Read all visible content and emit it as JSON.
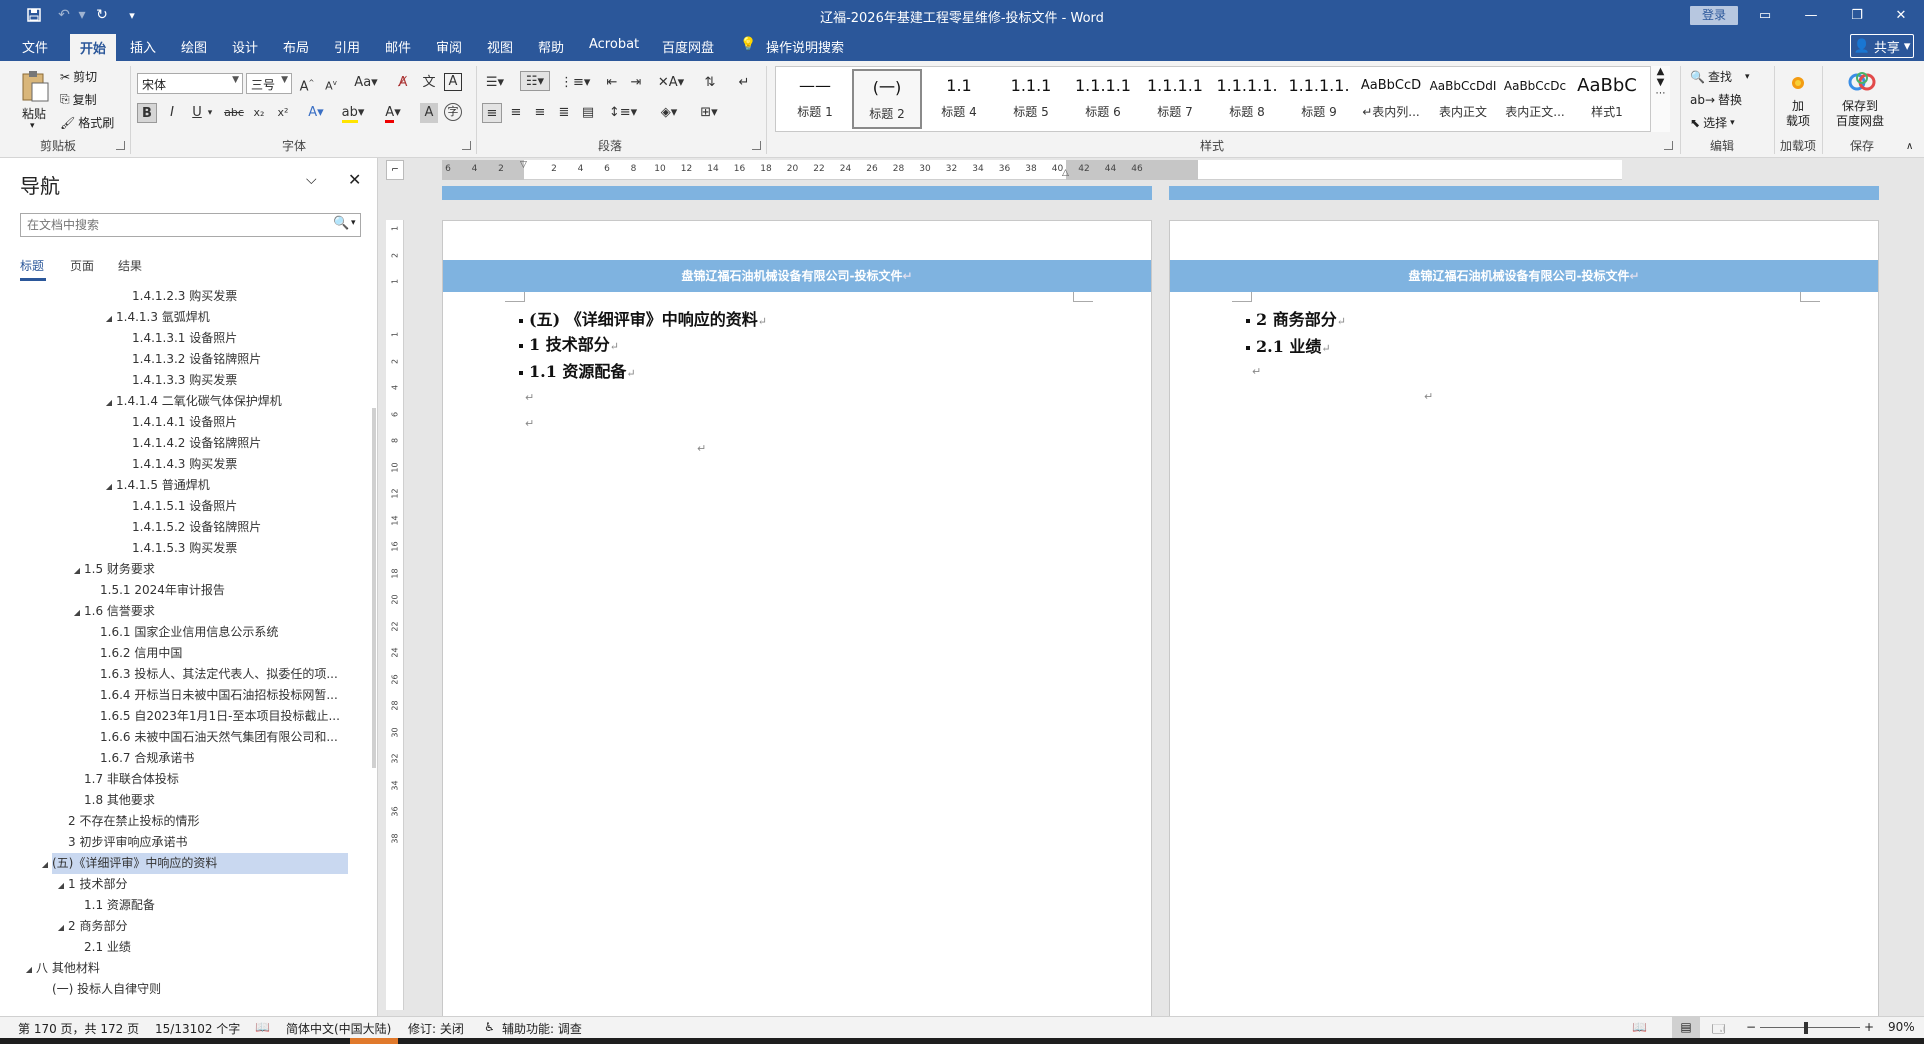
{
  "window": {
    "title": "辽福-2026年基建工程零星维修-投标文件 - Word",
    "login": "登录",
    "share": "共享"
  },
  "menu": [
    "文件",
    "开始",
    "插入",
    "绘图",
    "设计",
    "布局",
    "引用",
    "邮件",
    "审阅",
    "视图",
    "帮助",
    "Acrobat",
    "百度网盘",
    "操作说明搜索"
  ],
  "ribbon": {
    "clipboard": {
      "paste": "粘贴",
      "cut": "剪切",
      "copy": "复制",
      "format_painter": "格式刷",
      "label": "剪贴板"
    },
    "font": {
      "name": "宋体",
      "size": "三号",
      "label": "字体"
    },
    "paragraph": {
      "label": "段落"
    },
    "styles": {
      "label": "样式",
      "items": [
        {
          "preview": "——",
          "name": "标题 1"
        },
        {
          "preview": "(一)",
          "name": "标题 2"
        },
        {
          "preview": "1.1",
          "name": "标题 4"
        },
        {
          "preview": "1.1.1",
          "name": "标题 5"
        },
        {
          "preview": "1.1.1.1",
          "name": "标题 6"
        },
        {
          "preview": "1.1.1.1",
          "name": "标题 7"
        },
        {
          "preview": "1.1.1.1.",
          "name": "标题 8"
        },
        {
          "preview": "1.1.1.1.",
          "name": "标题 9"
        },
        {
          "preview": "AaBbCcD",
          "name": "↵表内列..."
        },
        {
          "preview": "AaBbCcDdI",
          "name": "表内正文"
        },
        {
          "preview": "AaBbCcDc",
          "name": "表内正文..."
        },
        {
          "preview": "AaBbC",
          "name": "样式1"
        }
      ]
    },
    "editing": {
      "find": "查找",
      "replace": "替换",
      "select": "选择",
      "label": "编辑"
    },
    "addins": {
      "btn": "加\n载项",
      "label": "加载项"
    },
    "save": {
      "btn": "保存到\n百度网盘",
      "label": "保存"
    }
  },
  "nav": {
    "title": "导航",
    "search_placeholder": "在文档中搜索",
    "tabs": [
      "标题",
      "页面",
      "结果"
    ],
    "items": [
      {
        "text": "1.4.1.2.3 购买发票",
        "level": 5,
        "tri": ""
      },
      {
        "text": "1.4.1.3 氩弧焊机",
        "level": 4,
        "tri": "◢"
      },
      {
        "text": "1.4.1.3.1 设备照片",
        "level": 5,
        "tri": ""
      },
      {
        "text": "1.4.1.3.2 设备铭牌照片",
        "level": 5,
        "tri": ""
      },
      {
        "text": "1.4.1.3.3 购买发票",
        "level": 5,
        "tri": ""
      },
      {
        "text": "1.4.1.4 二氧化碳气体保护焊机",
        "level": 4,
        "tri": "◢"
      },
      {
        "text": "1.4.1.4.1 设备照片",
        "level": 5,
        "tri": ""
      },
      {
        "text": "1.4.1.4.2 设备铭牌照片",
        "level": 5,
        "tri": ""
      },
      {
        "text": "1.4.1.4.3 购买发票",
        "level": 5,
        "tri": ""
      },
      {
        "text": "1.4.1.5 普通焊机",
        "level": 4,
        "tri": "◢"
      },
      {
        "text": "1.4.1.5.1 设备照片",
        "level": 5,
        "tri": ""
      },
      {
        "text": "1.4.1.5.2 设备铭牌照片",
        "level": 5,
        "tri": ""
      },
      {
        "text": "1.4.1.5.3 购买发票",
        "level": 5,
        "tri": ""
      },
      {
        "text": "1.5 财务要求",
        "level": 2,
        "tri": "◢"
      },
      {
        "text": "1.5.1 2024年审计报告",
        "level": 3,
        "tri": ""
      },
      {
        "text": "1.6 信誉要求",
        "level": 2,
        "tri": "◢"
      },
      {
        "text": "1.6.1 国家企业信用信息公示系统",
        "level": 3,
        "tri": ""
      },
      {
        "text": "1.6.2 信用中国",
        "level": 3,
        "tri": ""
      },
      {
        "text": "1.6.3 投标人、其法定代表人、拟委任的项...",
        "level": 3,
        "tri": ""
      },
      {
        "text": "1.6.4 开标当日未被中国石油招标投标网暂...",
        "level": 3,
        "tri": ""
      },
      {
        "text": "1.6.5 自2023年1月1日-至本项目投标截止...",
        "level": 3,
        "tri": ""
      },
      {
        "text": "1.6.6 未被中国石油天然气集团有限公司和...",
        "level": 3,
        "tri": ""
      },
      {
        "text": "1.6.7 合规承诺书",
        "level": 3,
        "tri": ""
      },
      {
        "text": "1.7 非联合体投标",
        "level": 2,
        "tri": ""
      },
      {
        "text": "1.8 其他要求",
        "level": 2,
        "tri": ""
      },
      {
        "text": "2 不存在禁止投标的情形",
        "level": 1,
        "tri": ""
      },
      {
        "text": "3 初步评审响应承诺书",
        "level": 1,
        "tri": ""
      },
      {
        "text": "(五)《详细评审》中响应的资料",
        "level": 0,
        "tri": "◢"
      },
      {
        "text": "1 技术部分",
        "level": 1,
        "tri": "◢"
      },
      {
        "text": "1.1 资源配备",
        "level": 2,
        "tri": ""
      },
      {
        "text": "2 商务部分",
        "level": 1,
        "tri": "◢"
      },
      {
        "text": "2.1 业绩",
        "level": 2,
        "tri": ""
      },
      {
        "text": "八 其他材料",
        "level": -1,
        "tri": "◢"
      },
      {
        "text": "(一) 投标人自律守则",
        "level": 0,
        "tri": ""
      }
    ]
  },
  "ruler": {
    "numbers": [
      "6",
      "4",
      "2",
      "",
      "2",
      "4",
      "6",
      "8",
      "10",
      "12",
      "14",
      "16",
      "18",
      "20",
      "22",
      "24",
      "26",
      "28",
      "30",
      "32",
      "34",
      "36",
      "38",
      "40",
      "42",
      "44",
      "46"
    ]
  },
  "vruler": {
    "numbers": [
      "1",
      "2",
      "1",
      "",
      "1",
      "2",
      "4",
      "6",
      "8",
      "10",
      "12",
      "14",
      "16",
      "18",
      "20",
      "22",
      "24",
      "26",
      "28",
      "30",
      "32",
      "34",
      "36",
      "38"
    ]
  },
  "pages": {
    "header_text": "盘锦辽福石油机械设备有限公司-投标文件",
    "left": [
      "(五) 《详细评审》中响应的资料",
      "1  技术部分",
      "1.1    资源配备"
    ],
    "right": [
      "2  商务部分",
      "2.1    业绩"
    ]
  },
  "status": {
    "page": "第 170 页，共 172 页",
    "words": "15/13102 个字",
    "language": "简体中文(中国大陆)",
    "track": "修订: 关闭",
    "accessibility": "辅助功能: 调查",
    "zoom": "90%"
  }
}
